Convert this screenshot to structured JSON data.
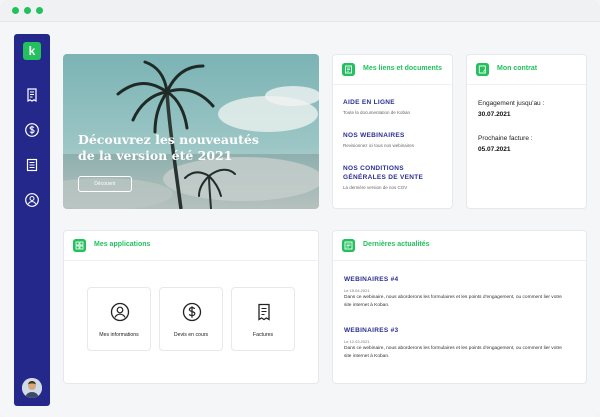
{
  "sidebar": {
    "logo_letter": "k",
    "items": [
      {
        "icon": "receipt-icon"
      },
      {
        "icon": "dollar-icon"
      },
      {
        "icon": "document-icon"
      },
      {
        "icon": "user-icon"
      }
    ]
  },
  "hero": {
    "title": "Découvrez les nouveautés de la version été 2021",
    "button_label": "Découvrir"
  },
  "links_card": {
    "title": "Mes liens et documents",
    "items": [
      {
        "title": "AIDE EN LIGNE",
        "subtitle": "Toute la documentation de Koban"
      },
      {
        "title": "NOS WEBINAIRES",
        "subtitle": "Revisionnez ici tous nos webinaires"
      },
      {
        "title": "NOS CONDITIONS GÉNÉRALES DE VENTE",
        "subtitle": "La dernière version de nos CGV"
      }
    ]
  },
  "contract_card": {
    "title": "Mon contrat",
    "engagement_label": "Engagement jusqu'au :",
    "engagement_value": "30.07.2021",
    "invoice_label": "Prochaine facture :",
    "invoice_value": "05.07.2021"
  },
  "apps_card": {
    "title": "Mes applications",
    "apps": [
      {
        "label": "Mes informations",
        "icon": "user-icon"
      },
      {
        "label": "Devis en cours",
        "icon": "dollar-icon"
      },
      {
        "label": "Factures",
        "icon": "receipt-icon"
      }
    ]
  },
  "news_card": {
    "title": "Dernières actualités",
    "items": [
      {
        "title": "WEBINAIRES #4",
        "date": "Le 15.04.2021",
        "text": "Dans ce webinaire, nous aborderons les formulaires et les points d'engagement, ou comment lier votre site internet à Koban."
      },
      {
        "title": "WEBINAIRES #3",
        "date": "Le 12.03.2021",
        "text": "Dans ce webinaire, nous aborderons les formulaires et les points d'engagement, ou comment lier votre site internet à Koban."
      }
    ]
  },
  "colors": {
    "sidebar": "#24288a",
    "accent_green": "#22c15e",
    "link_blue": "#2a2f8f"
  }
}
